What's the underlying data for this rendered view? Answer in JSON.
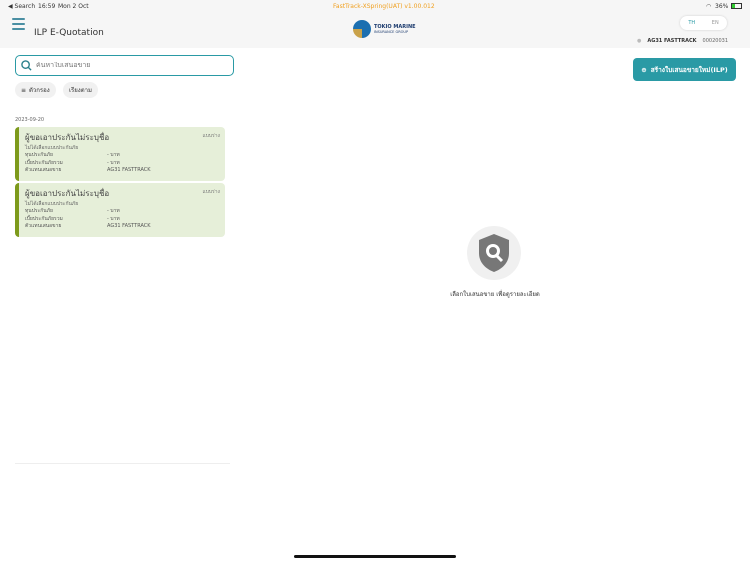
{
  "status": {
    "back": "◀ Search",
    "time": "16:59",
    "date": "Mon 2 Oct",
    "app_version": "FastTrack-XSpring(UAT) v1.00.012",
    "battery": "36%"
  },
  "header": {
    "title": "ILP E-Quotation",
    "logo_line1": "TOKIO MARINE",
    "logo_line2": "INSURANCE GROUP",
    "lang": [
      "TH",
      "EN"
    ],
    "agent_name": "AG31 FASTTRACK",
    "agent_code": "00020031"
  },
  "search": {
    "placeholder": "ค้นหาใบเสนอขาย"
  },
  "filter_label": "ตัวกรอง",
  "sort_label": "เรียงตาม",
  "new_button": "สร้างใบเสนอขายใหม่(ILP)",
  "group_date": "2023-09-20",
  "cards": [
    {
      "name": "ผู้ขอเอาประกันไม่ระบุชื่อ",
      "plan": "ไม่ได้เลือกแบบประกันภัย",
      "status": "แบบร่าง",
      "rows": [
        [
          "ทุนประกันภัย",
          "- บาท"
        ],
        [
          "เบี้ยประกันภัยรวม",
          "- บาท"
        ],
        [
          "ตัวแทนเสนอขาย",
          "AG31 FASTTRACK"
        ]
      ]
    },
    {
      "name": "ผู้ขอเอาประกันไม่ระบุชื่อ",
      "plan": "ไม่ได้เลือกแบบประกันภัย",
      "status": "แบบร่าง",
      "rows": [
        [
          "ทุนประกันภัย",
          "- บาท"
        ],
        [
          "เบี้ยประกันภัยรวม",
          "- บาท"
        ],
        [
          "ตัวแทนเสนอขาย",
          "AG31 FASTTRACK"
        ]
      ]
    }
  ],
  "empty_text": "เลือกใบเสนอขาย เพื่อดูรายละเอียด"
}
